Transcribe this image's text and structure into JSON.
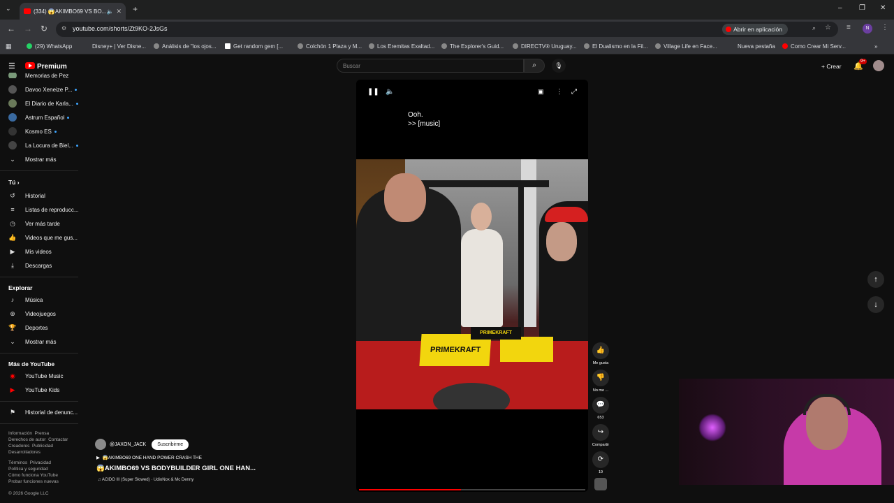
{
  "browser": {
    "tab_title": "(334) 😱AKIMBO69 VS BO...",
    "url": "youtube.com/shorts/Zt9KO-2JsGs",
    "open_in_app": "Abrir en aplicación",
    "bookmarks": [
      "(29) WhatsApp",
      "Disney+ | Ver Disne...",
      "Análisis de \"los ojos...",
      "Get random gem [...",
      "Colchón 1 Plaza y M...",
      "Los Eremitas Exaltad...",
      "The Explorer's Guid...",
      "DIRECTV® Uruguay...",
      "El Dualismo en la Fil...",
      "Village Life en Face...",
      "Nueva pestaña",
      "Como Crear Mi Serv..."
    ]
  },
  "masthead": {
    "logo": "Premium",
    "search_placeholder": "Buscar",
    "create_label": "Crear",
    "notifications_count": "9+"
  },
  "sidebar": {
    "subscriptions": [
      "Memorias de Pez",
      "Davoo Xeneize P...",
      "El Diario de Karla...",
      "Astrum Español",
      "Kosmo ES",
      "La Locura de Biel..."
    ],
    "show_more": "Mostrar más",
    "you_header": "Tú",
    "you_items": [
      "Historial",
      "Listas de reproducc...",
      "Ver más tarde",
      "Videos que me gus...",
      "Mis videos",
      "Descargas"
    ],
    "explore_header": "Explorar",
    "explore_items": [
      "Música",
      "Videojuegos",
      "Deportes"
    ],
    "explore_more": "Mostrar más",
    "more_header": "Más de YouTube",
    "more_items": [
      "YouTube Music",
      "YouTube Kids"
    ],
    "report_history": "Historial de denunc...",
    "footer1": "Información  Prensa\nDerechos de autor  Contactar\nCreadores  Publicidad\nDesarrolladores",
    "footer2": "Términos  Privacidad\nPolítica y seguridad\nCómo funciona YouTube\nProbar funciones nuevas",
    "copyright": "© 2026 Google LLC"
  },
  "short": {
    "caption_line1": "Ooh.",
    "caption_line2": ">> [music]",
    "channel": "@JAXON_JACK",
    "subscribe_label": "Suscribirme",
    "sub_title": "😱AKIMBO69 ONE HAND POWER CRASH THE",
    "title": "😱AKIMBO69 VS BODYBUILDER GIRL ONE HAN...",
    "music": "♫ ACIDO III (Super Slowed) · UdioNox & Mc Denny",
    "progress": 0.45,
    "brand_text": "PRIMEKRAFT"
  },
  "actions": {
    "like_label": "Me gusta",
    "dislike_label": "No me ...",
    "comments_count": "653",
    "share_label": "Compartir",
    "remix_count": "19"
  }
}
